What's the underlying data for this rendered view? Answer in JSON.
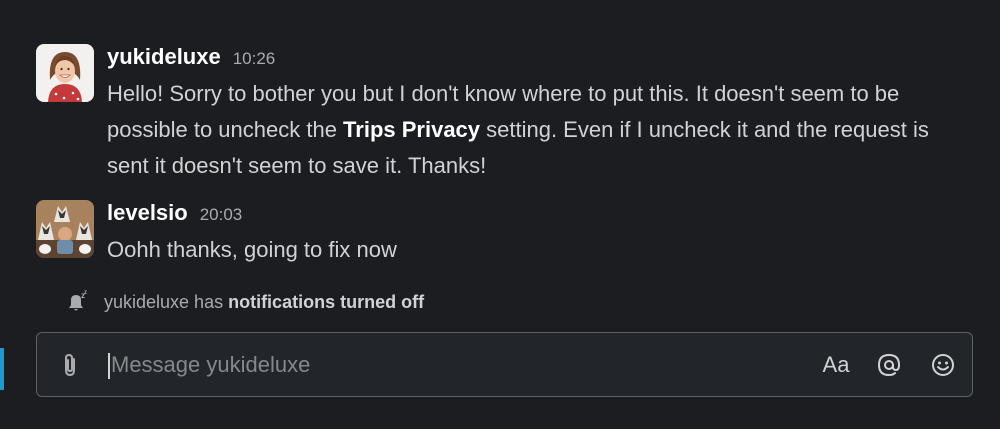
{
  "messages": [
    {
      "author": "yukideluxe",
      "time": "10:26",
      "text_parts": [
        "Hello! Sorry to bother you but I don't know where to put this. It doesn't seem to be possible to uncheck the ",
        "Trips Privacy",
        " setting. Even if I uncheck it and the request is sent it doesn't seem to save it. Thanks!"
      ]
    },
    {
      "author": "levelsio",
      "time": "20:03",
      "text": "Oohh thanks, going to fix now"
    }
  ],
  "notice": {
    "icon": "bell-snooze-icon",
    "prefix": "yukideluxe has ",
    "bold": "notifications turned off"
  },
  "composer": {
    "placeholder": "Message yukideluxe",
    "value": "",
    "format_label": "Aa",
    "icons": [
      "paperclip-icon",
      "at-icon",
      "emoji-icon"
    ]
  },
  "colors": {
    "background": "#1b1d21",
    "accent": "#1d9bd1",
    "author": "#ffffff",
    "text": "#d1d2d3",
    "muted": "#ababad"
  }
}
